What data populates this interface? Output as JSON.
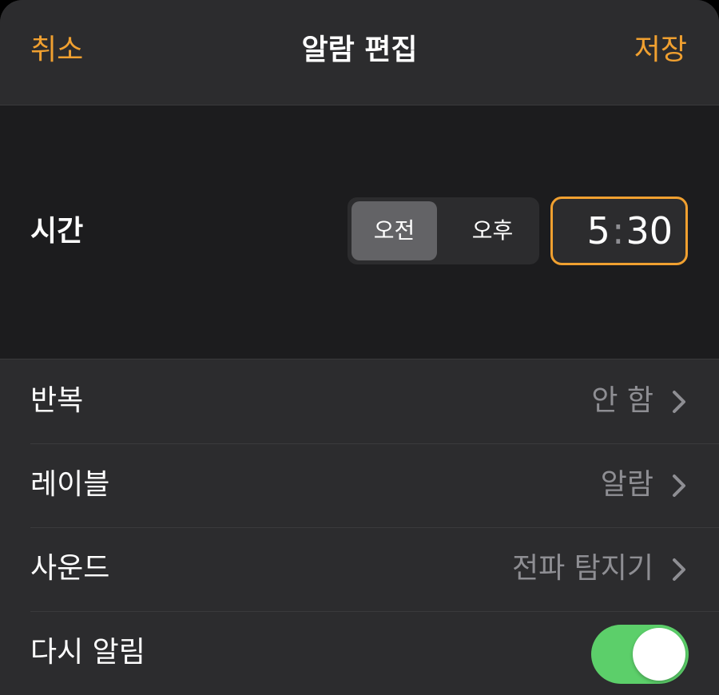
{
  "nav": {
    "cancel_label": "취소",
    "title": "알람 편집",
    "save_label": "저장"
  },
  "time_picker": {
    "label": "시간",
    "am_label": "오전",
    "pm_label": "오후",
    "selected_period": "오전",
    "hour": "5",
    "minute": "30"
  },
  "rows": [
    {
      "label": "반복",
      "value": "안 함",
      "icon": "chevron-right-icon"
    },
    {
      "label": "레이블",
      "value": "알람",
      "icon": "chevron-right-icon"
    },
    {
      "label": "사운드",
      "value": "전파 탐지기",
      "icon": "chevron-right-icon"
    },
    {
      "label": "다시 알림",
      "toggle_on": true
    }
  ],
  "colors": {
    "accent": "#f0a030",
    "toggle_on": "#5ccf6a",
    "background": "#2c2c2e",
    "time_section_background": "#1c1c1e",
    "secondary_text": "#8e8e93"
  }
}
